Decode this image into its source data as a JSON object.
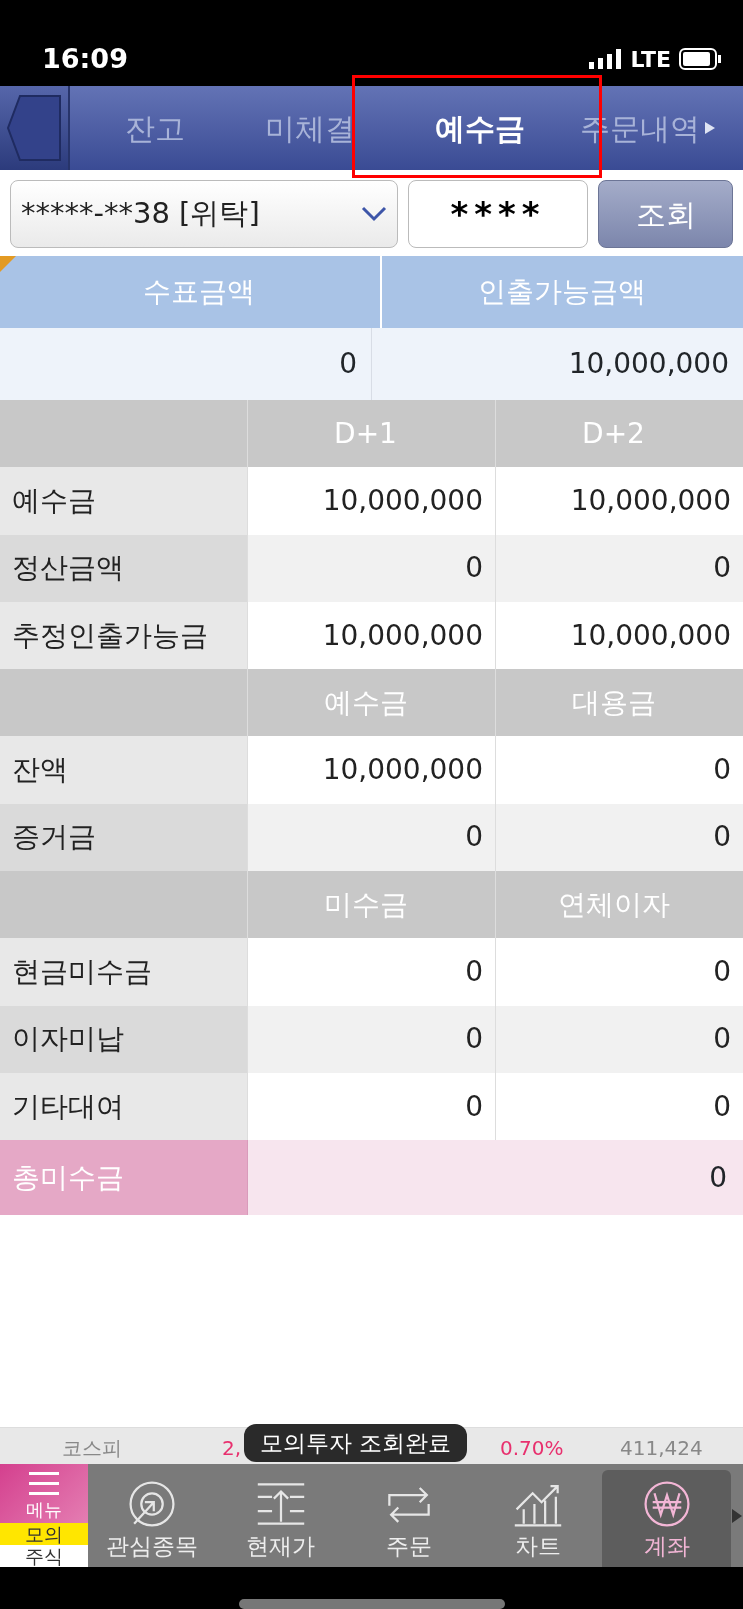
{
  "status_bar": {
    "time": "16:09",
    "network": "LTE"
  },
  "top_tabs": [
    {
      "label": "잔고",
      "selected": false,
      "annotated": false
    },
    {
      "label": "미체결",
      "selected": false,
      "annotated": false
    },
    {
      "label": "예수금",
      "selected": true,
      "annotated": true
    },
    {
      "label": "주문내역",
      "selected": false,
      "annotated": false
    }
  ],
  "account_select": {
    "value": "*****-**38 [위탁]"
  },
  "password_field": {
    "value": "****"
  },
  "query_button": "조회",
  "summary": {
    "columns": [
      "수표금액",
      "인출가능금액"
    ],
    "values": [
      "0",
      "10,000,000"
    ]
  },
  "sections": [
    {
      "columns": [
        "D+1",
        "D+2"
      ],
      "rows": [
        {
          "label": "예수금",
          "values": [
            "10,000,000",
            "10,000,000"
          ]
        },
        {
          "label": "정산금액",
          "values": [
            "0",
            "0"
          ]
        },
        {
          "label": "추정인출가능금",
          "values": [
            "10,000,000",
            "10,000,000"
          ]
        }
      ]
    },
    {
      "columns": [
        "예수금",
        "대용금"
      ],
      "rows": [
        {
          "label": "잔액",
          "values": [
            "10,000,000",
            "0"
          ]
        },
        {
          "label": "증거금",
          "values": [
            "0",
            "0"
          ]
        }
      ]
    },
    {
      "columns": [
        "미수금",
        "연체이자"
      ],
      "rows": [
        {
          "label": "현금미수금",
          "values": [
            "0",
            "0"
          ]
        },
        {
          "label": "이자미납",
          "values": [
            "0",
            "0"
          ]
        },
        {
          "label": "기타대여",
          "values": [
            "0",
            "0"
          ]
        }
      ]
    }
  ],
  "total": {
    "label": "총미수금",
    "value": "0"
  },
  "ticker": [
    {
      "text": "코스피",
      "kind": "name"
    },
    {
      "text": "2,",
      "kind": "up"
    },
    {
      "text": "0.70%",
      "kind": "up"
    },
    {
      "text": "411,424",
      "kind": "volume"
    }
  ],
  "toast": "모의투자 조회완료",
  "menu_button": {
    "label": "메뉴",
    "badge_top": "모의",
    "badge_bottom": "주식"
  },
  "bottom_nav": [
    {
      "label": "관심종목",
      "kind": "target",
      "selected": false
    },
    {
      "label": "현재가",
      "kind": "list",
      "selected": false
    },
    {
      "label": "주문",
      "kind": "swap",
      "selected": false
    },
    {
      "label": "차트",
      "kind": "chart",
      "selected": false
    },
    {
      "label": "계좌",
      "kind": "won",
      "selected": true
    }
  ]
}
